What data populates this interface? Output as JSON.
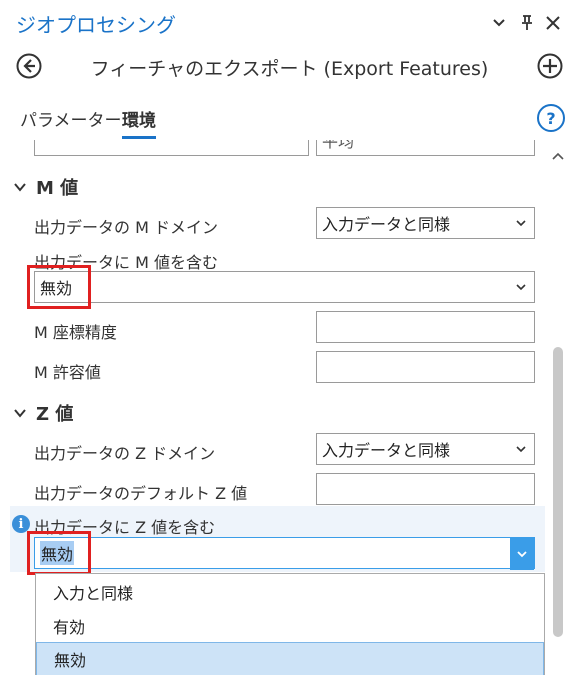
{
  "pane": {
    "title": "ジオプロセシング",
    "tool_title": "フィーチャのエクスポート (Export Features)",
    "tabs": [
      "パラメーター",
      "環境"
    ],
    "active_tab": "環境"
  },
  "content": {
    "top_field_partial_text": "平均",
    "m_section": {
      "title": "M 値",
      "domain_label": "出力データの M ドメイン",
      "domain_value": "入力データと同様",
      "include_label": "出力データに M 値を含む",
      "include_value": "無効",
      "resolution_label": "M 座標精度",
      "resolution_value": "",
      "tolerance_label": "M 許容値",
      "tolerance_value": ""
    },
    "z_section": {
      "title": "Z 値",
      "domain_label": "出力データの Z ドメイン",
      "domain_value": "入力データと同様",
      "default_label": "出力データのデフォルト Z 値",
      "default_value": "",
      "include_label": "出力データに Z 値を含む",
      "include_value": "無効"
    },
    "dropdown_options": [
      "入力と同様",
      "有効",
      "無効"
    ],
    "dropdown_selected": "無効"
  },
  "colors": {
    "accent": "#1a73c8",
    "highlight_red": "#e02020",
    "selection": "#cde3f7"
  },
  "icons": [
    "menu-chevron-icon",
    "pin-icon",
    "close-icon",
    "back-icon",
    "add-icon",
    "help-icon",
    "collapse-chevron-icon",
    "info-icon",
    "dropdown-arrow-icon",
    "scroll-up-icon"
  ]
}
